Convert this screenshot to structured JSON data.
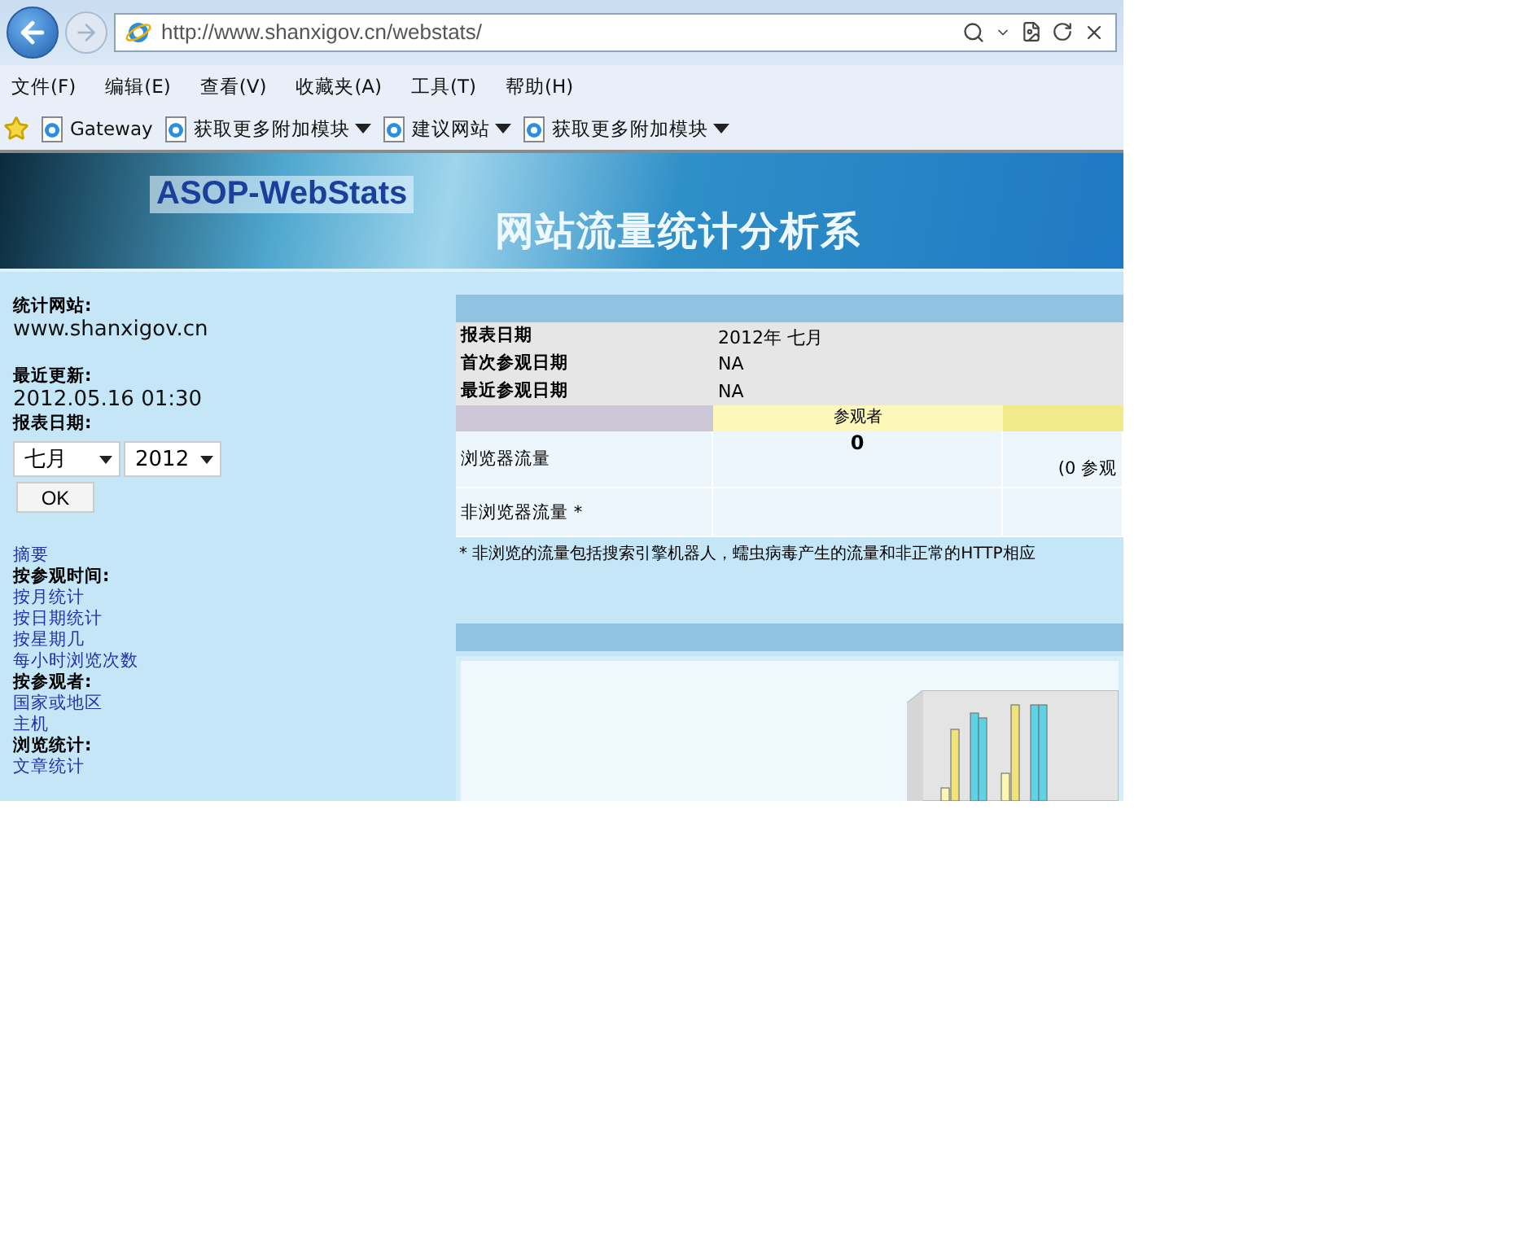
{
  "browser": {
    "address": "http://www.shanxigov.cn/webstats/",
    "back_disabled": false,
    "forward_disabled": true
  },
  "menu": [
    "文件(F)",
    "编辑(E)",
    "查看(V)",
    "收藏夹(A)",
    "工具(T)",
    "帮助(H)"
  ],
  "favorites": [
    {
      "label": "Gateway",
      "dropdown": false
    },
    {
      "label": "获取更多附加模块",
      "dropdown": true
    },
    {
      "label": "建议网站",
      "dropdown": true
    },
    {
      "label": "获取更多附加模块",
      "dropdown": true
    }
  ],
  "banner": {
    "logo": "ASOP-WebStats",
    "title": "网站流量统计分析系"
  },
  "sidebar": {
    "site_label": "统计网站:",
    "site": "www.shanxigov.cn",
    "updated_label": "最近更新:",
    "updated": "2012.05.16 01:30",
    "date_label": "报表日期:",
    "month": "七月",
    "year": "2012",
    "ok": "OK",
    "nav": [
      {
        "kind": "link",
        "label": "摘要"
      },
      {
        "kind": "heading",
        "label": "按参观时间:"
      },
      {
        "kind": "link",
        "label": "按月统计"
      },
      {
        "kind": "link",
        "label": "按日期统计"
      },
      {
        "kind": "link",
        "label": "按星期几"
      },
      {
        "kind": "link",
        "label": "每小时浏览次数"
      },
      {
        "kind": "heading",
        "label": "按参观者:"
      },
      {
        "kind": "link",
        "label": "国家或地区"
      },
      {
        "kind": "link",
        "label": "主机"
      },
      {
        "kind": "heading",
        "label": "浏览统计:"
      },
      {
        "kind": "link",
        "label": "文章统计"
      }
    ]
  },
  "summary": {
    "info": [
      {
        "label": "报表日期",
        "value": "2012年 七月"
      },
      {
        "label": "首次参观日期",
        "value": "NA"
      },
      {
        "label": "最近参观日期",
        "value": "NA"
      }
    ],
    "columns": [
      "参观者"
    ],
    "rows": [
      {
        "label": "浏览器流量",
        "column_2": "0",
        "column_3": "(0 参观"
      },
      {
        "label": "非浏览器流量 *",
        "column_2": "",
        "column_3": ""
      }
    ],
    "footnote": "* 非浏览的流量包括搜索引擎机器人，蠕虫病毒产生的流量和非正常的HTTP相应"
  }
}
